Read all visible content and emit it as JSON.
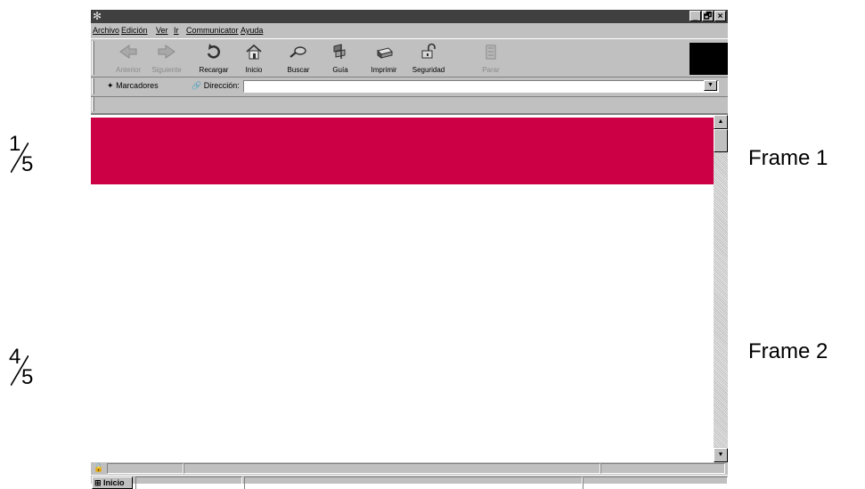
{
  "labels": {
    "frame1_fraction": {
      "numerator": "1",
      "denominator": "5"
    },
    "frame2_fraction": {
      "numerator": "4",
      "denominator": "5"
    },
    "frame1_name": "Frame 1",
    "frame2_name": "Frame 2"
  },
  "window": {
    "controls": {
      "minimize": "_",
      "maximize": "🗗",
      "close": "×"
    }
  },
  "menu": {
    "items": [
      "Archivo",
      "Edición",
      "Ver",
      "Ir",
      "Communicator",
      "Ayuda"
    ]
  },
  "toolbar": {
    "buttons": [
      {
        "label": "Anterior",
        "icon": "back-arrow-icon",
        "enabled": false
      },
      {
        "label": "Siguiente",
        "icon": "forward-arrow-icon",
        "enabled": false
      },
      {
        "label": "Recargar",
        "icon": "reload-icon",
        "enabled": true
      },
      {
        "label": "Inicio",
        "icon": "home-icon",
        "enabled": true
      },
      {
        "label": "Buscar",
        "icon": "search-icon",
        "enabled": true
      },
      {
        "label": "Guía",
        "icon": "guide-icon",
        "enabled": true
      },
      {
        "label": "Imprimir",
        "icon": "printer-icon",
        "enabled": true
      },
      {
        "label": "Seguridad",
        "icon": "lock-icon",
        "enabled": true
      },
      {
        "label": "Parar",
        "icon": "stop-icon",
        "enabled": false
      }
    ]
  },
  "location": {
    "bookmarks_label": "Marcadores",
    "address_label": "Dirección:",
    "address_value": ""
  },
  "taskbar": {
    "start_label": "Inicio"
  },
  "colors": {
    "frame1_fill": "#cc0044",
    "window_chrome": "#c0c0c0",
    "titlebar": "#404040"
  }
}
